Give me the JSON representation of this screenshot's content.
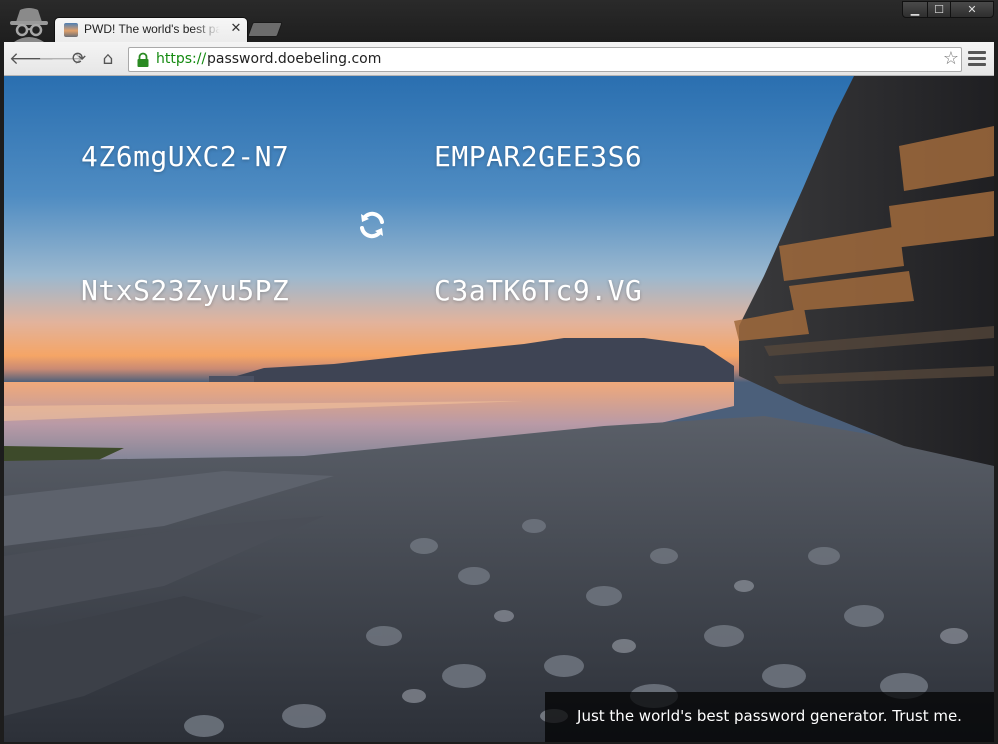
{
  "tab": {
    "title": "PWD! The world's best password generator",
    "close_glyph": "✕"
  },
  "window_controls": {
    "minimize": "▁",
    "maximize": "☐",
    "close": "✕"
  },
  "toolbar": {
    "back_glyph": "🡐",
    "forward_glyph": "🡒",
    "reload_glyph": "⟳",
    "home_glyph": "⌂"
  },
  "address": {
    "scheme": "https://",
    "host": "password.doebeling.com",
    "star_glyph": "☆"
  },
  "passwords": [
    "4Z6mgUXC2-N7",
    "EMPAR2GEE3S6",
    "NtxS23Zyu5PZ",
    "C3aTK6Tc9.VG"
  ],
  "tagline": "Just the world's best password generator. Trust me.",
  "icons": {
    "incognito": "incognito-icon",
    "lock": "lock-icon",
    "refresh": "refresh-icon",
    "menu": "menu-icon"
  },
  "colors": {
    "url_scheme": "#138a0f",
    "password_text": "#ffffff",
    "tagline_bg": "#000000"
  }
}
